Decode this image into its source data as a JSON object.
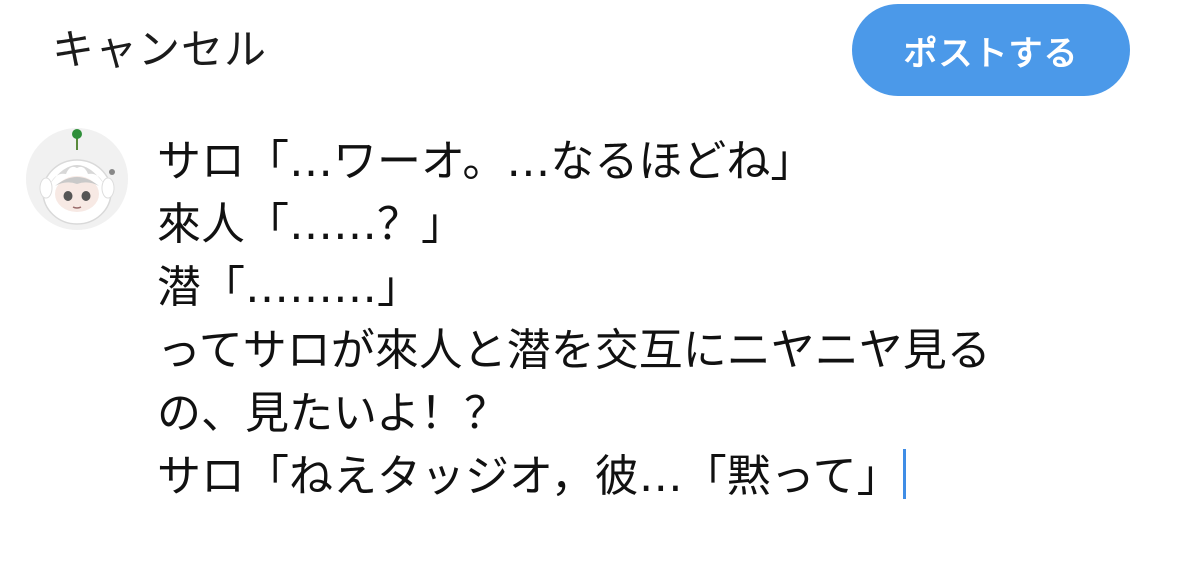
{
  "header": {
    "cancel_label": "キャンセル",
    "post_label": "ポストする"
  },
  "composer": {
    "lines": [
      "サロ「…ワーオ。…なるほどね」",
      "來人「……？」",
      "潜「………」",
      "ってサロが來人と潜を交互にニヤニヤ見る",
      "の、見たいよ！？",
      "サロ「ねえタッジオ，彼…「黙って」"
    ]
  },
  "colors": {
    "accent": "#4b99e9",
    "caret": "#3f8de6",
    "text": "#111111"
  }
}
